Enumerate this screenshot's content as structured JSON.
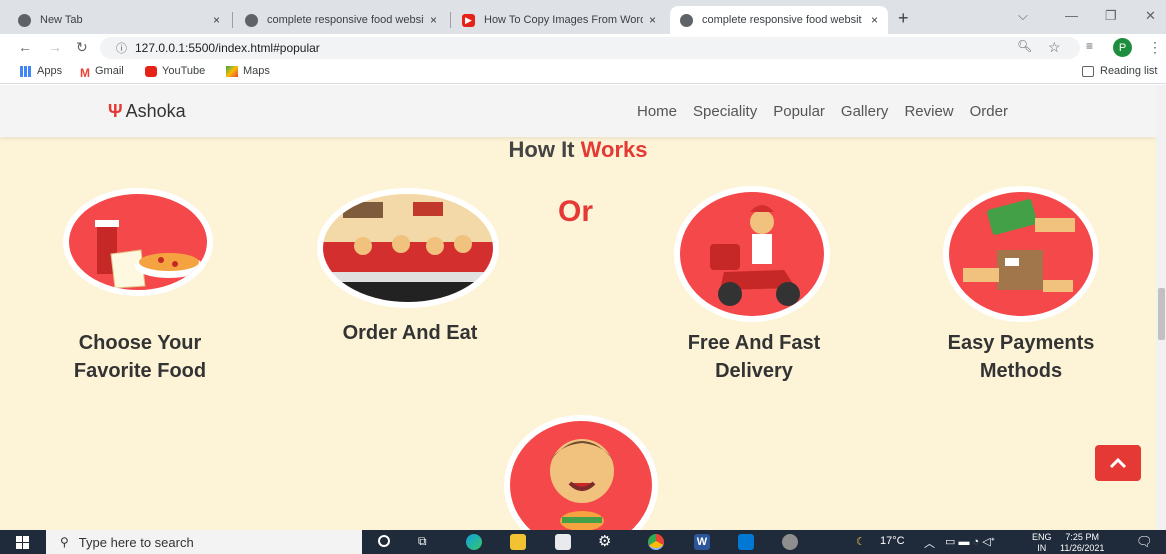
{
  "browser": {
    "tabs": [
      {
        "title": "New Tab",
        "icon": "chrome-icon",
        "close": "×"
      },
      {
        "title": "complete responsive food websit",
        "icon": "globe-icon",
        "close": "×"
      },
      {
        "title": "How To Copy Images From Word",
        "icon": "youtube-icon",
        "close": "×"
      },
      {
        "title": "complete responsive food websit",
        "icon": "globe-icon",
        "close": "×",
        "active": true
      }
    ],
    "new_tab": "+",
    "url": "127.0.0.1:5500/index.html#popular",
    "profile_initial": "P",
    "bookmarks": [
      {
        "label": "Apps"
      },
      {
        "label": "Gmail"
      },
      {
        "label": "YouTube"
      },
      {
        "label": "Maps"
      }
    ],
    "reading_list": "Reading list"
  },
  "site": {
    "logo": "Ashoka",
    "nav": [
      "Home",
      "Speciality",
      "Popular",
      "Gallery",
      "Review",
      "Order"
    ],
    "section_title_a": "How It",
    "section_title_b": "Works",
    "or_label": "Or",
    "steps": [
      {
        "line1": "Choose Your",
        "line2": "Favorite Food"
      },
      {
        "line1": "Order And Eat",
        "line2": ""
      },
      {
        "line1": "Free And Fast",
        "line2": "Delivery"
      },
      {
        "line1": "Easy Payments",
        "line2": "Methods"
      }
    ],
    "accent_color": "#e53935",
    "background_color": "#fdf4d8"
  },
  "taskbar": {
    "search_placeholder": "Type here to search",
    "weather": "17°C",
    "lang_top": "ENG",
    "lang_bottom": "IN",
    "time": "7:25 PM",
    "date": "11/26/2021"
  }
}
